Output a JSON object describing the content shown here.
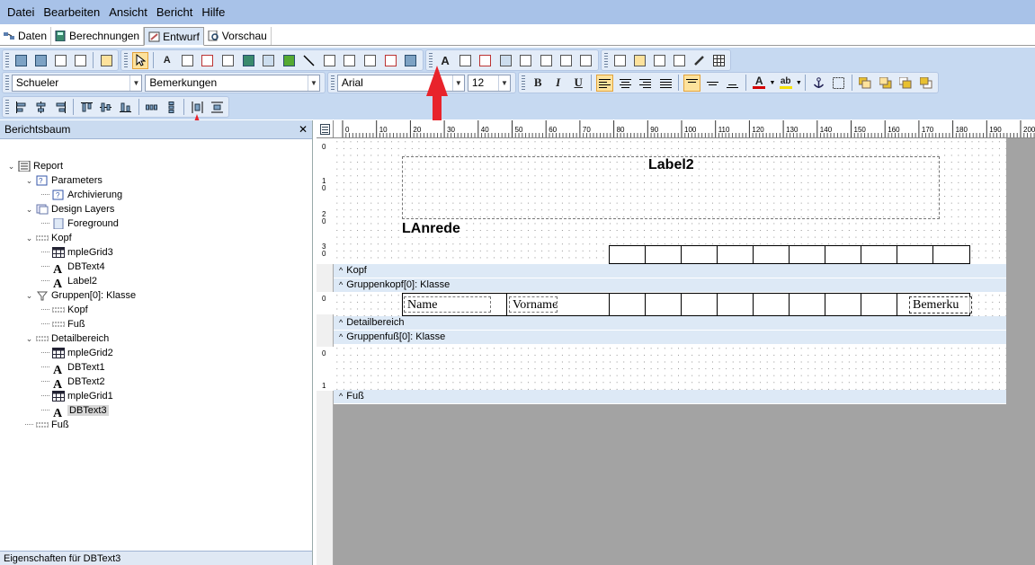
{
  "menu": {
    "items": [
      "Datei",
      "Bearbeiten",
      "Ansicht",
      "Bericht",
      "Hilfe"
    ]
  },
  "tabs": [
    {
      "label": "Daten",
      "icon": "data-icon"
    },
    {
      "label": "Berechnungen",
      "icon": "calculator-icon"
    },
    {
      "label": "Entwurf",
      "icon": "design-icon",
      "active": true
    },
    {
      "label": "Vorschau",
      "icon": "preview-icon"
    }
  ],
  "toolbar": {
    "datasource": "Schueler",
    "datafield": "Bemerkungen",
    "font": "Arial",
    "fontsize": "12",
    "bold": "B",
    "italic": "I",
    "underline": "U",
    "label_tool": "A",
    "font_color_letter": "A",
    "highlight_letters": "ab",
    "accent_color": "#d40000"
  },
  "panel": {
    "title": "Berichtsbaum",
    "close": "✕",
    "tree": [
      {
        "label": "Report",
        "level": 0,
        "expand": "v",
        "icon": "report-icon"
      },
      {
        "label": "Parameters",
        "level": 1,
        "expand": "v",
        "icon": "parameters-icon"
      },
      {
        "label": "Archivierung",
        "level": 2,
        "icon": "parameter-icon"
      },
      {
        "label": "Design Layers",
        "level": 1,
        "expand": "v",
        "icon": "layers-icon"
      },
      {
        "label": "Foreground",
        "level": 2,
        "icon": "layer-icon"
      },
      {
        "label": "Kopf",
        "level": 1,
        "expand": "v",
        "icon": "band-icon"
      },
      {
        "label": "mpleGrid3",
        "level": 2,
        "icon": "grid-icon"
      },
      {
        "label": "DBText4",
        "level": 2,
        "icon": "text-icon"
      },
      {
        "label": "Label2",
        "level": 2,
        "icon": "text-icon"
      },
      {
        "label": "Gruppen[0]: Klasse",
        "level": 1,
        "expand": "v",
        "icon": "group-icon"
      },
      {
        "label": "Kopf",
        "level": 2,
        "icon": "band-icon"
      },
      {
        "label": "Fuß",
        "level": 2,
        "icon": "band-icon"
      },
      {
        "label": "Detailbereich",
        "level": 1,
        "expand": "v",
        "icon": "band-icon"
      },
      {
        "label": "mpleGrid2",
        "level": 2,
        "icon": "grid-icon"
      },
      {
        "label": "DBText1",
        "level": 2,
        "icon": "text-icon"
      },
      {
        "label": "DBText2",
        "level": 2,
        "icon": "text-icon"
      },
      {
        "label": "mpleGrid1",
        "level": 2,
        "icon": "grid-icon"
      },
      {
        "label": "DBText3",
        "level": 2,
        "icon": "text-icon",
        "selected": true
      },
      {
        "label": "Fuß",
        "level": 1,
        "icon": "band-icon"
      }
    ],
    "footer": "Eigenschaften für DBText3"
  },
  "ruler": {
    "ticks": [
      "0",
      "10",
      "20",
      "30",
      "40",
      "50",
      "60",
      "70",
      "80",
      "90",
      "100",
      "110",
      "120",
      "130",
      "140",
      "150",
      "160",
      "170",
      "180",
      "190",
      "200"
    ]
  },
  "vruler": {
    "labels": [
      "0",
      "1\n0",
      "2\n0",
      "3\n0",
      "0",
      "0",
      "1"
    ]
  },
  "bands": {
    "kopf": "Kopf",
    "gruppenkopf": "Gruppenkopf[0]: Klasse",
    "detail": "Detailbereich",
    "gruppenfuss": "Gruppenfuß[0]: Klasse",
    "fuss": "Fuß",
    "caret": "^"
  },
  "report": {
    "label2": "Label2",
    "lanrede": "LAnrede",
    "name": "Name",
    "vorname": "Vorname",
    "bemerkungen": "Bemerku"
  }
}
